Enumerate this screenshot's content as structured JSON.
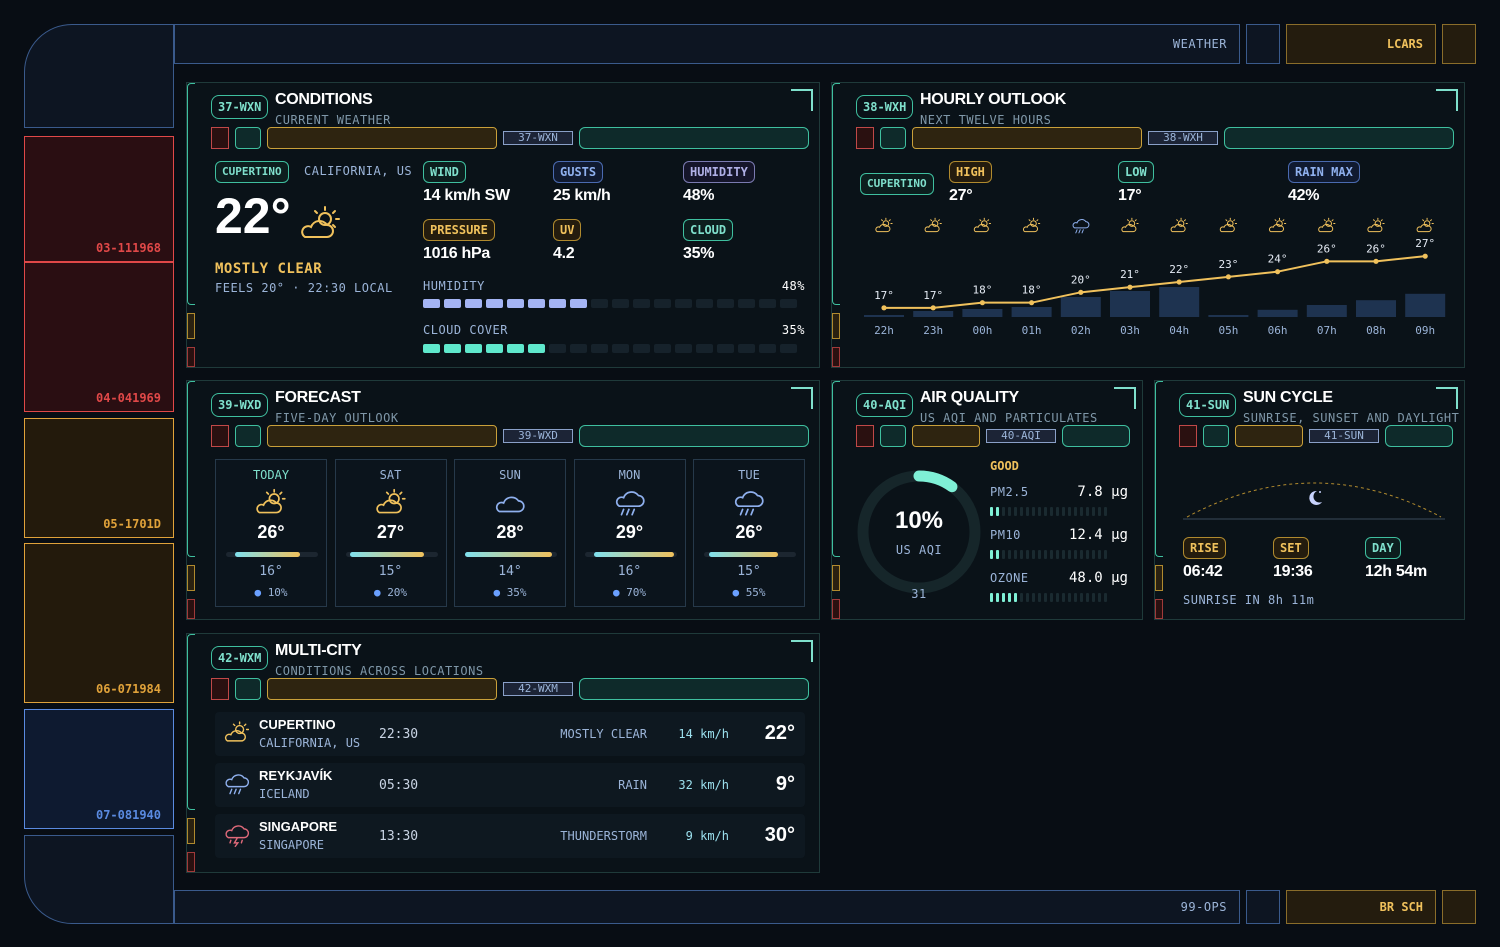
{
  "header": {
    "title": "WEATHER",
    "right_label": "LCARS"
  },
  "footer": {
    "code": "99-OPS",
    "right_label": "BR SCH"
  },
  "sidebar": {
    "tiles": [
      {
        "code": "03-111968",
        "color": "#e04848"
      },
      {
        "code": "04-041969",
        "color": "#e04848"
      },
      {
        "code": "05-1701D",
        "color": "#e0a23a"
      },
      {
        "code": "06-071984",
        "color": "#e0a23a"
      },
      {
        "code": "07-081940",
        "color": "#5a8ae0"
      }
    ]
  },
  "conditions": {
    "code": "37-WXN",
    "title": "CONDITIONS",
    "subtitle": "CURRENT WEATHER",
    "bar_code": "37-WXN",
    "city": "CUPERTINO",
    "region": "CALIFORNIA, US",
    "temp": "22°",
    "summary": "MOSTLY CLEAR",
    "feels": "FEELS 20° · 22:30 LOCAL",
    "stats": [
      {
        "label": "WIND",
        "value": "14 km/h SW",
        "style": "teal"
      },
      {
        "label": "GUSTS",
        "value": "25 km/h",
        "style": "blue"
      },
      {
        "label": "HUMIDITY",
        "value": "48%",
        "style": "lav"
      },
      {
        "label": "PRESSURE",
        "value": "1016 hPa",
        "style": "gold"
      },
      {
        "label": "UV",
        "value": "4.2",
        "style": "gold"
      },
      {
        "label": "CLOUD",
        "value": "35%",
        "style": "teal"
      }
    ],
    "humidity_label": "HUMIDITY",
    "humidity_value": "48%",
    "humidity_fraction": 0.48,
    "cloud_label": "CLOUD COVER",
    "cloud_value": "35%",
    "cloud_fraction": 0.35
  },
  "hourly": {
    "code": "38-WXH",
    "title": "HOURLY OUTLOOK",
    "subtitle": "NEXT TWELVE HOURS",
    "bar_code": "38-WXH",
    "city": "CUPERTINO",
    "high_label": "HIGH",
    "high_value": "27°",
    "low_label": "LOW",
    "low_value": "17°",
    "rain_label": "RAIN MAX",
    "rain_value": "42%"
  },
  "chart_data": {
    "type": "line",
    "x": [
      "22h",
      "23h",
      "00h",
      "01h",
      "02h",
      "03h",
      "04h",
      "05h",
      "06h",
      "07h",
      "08h",
      "09h"
    ],
    "series": [
      {
        "values": [
          17,
          17,
          18,
          18,
          20,
          21,
          22,
          23,
          24,
          26,
          26,
          27
        ]
      }
    ],
    "temp_labels": [
      "17°",
      "17°",
      "18°",
      "18°",
      "20°",
      "21°",
      "22°",
      "23°",
      "24°",
      "26°",
      "26°",
      "27°"
    ],
    "precip": [
      0.05,
      0.15,
      0.2,
      0.25,
      0.5,
      0.65,
      0.75,
      0.05,
      0.18,
      0.3,
      0.42,
      0.58
    ],
    "icons": [
      "partly",
      "partly",
      "partly",
      "partly",
      "rain",
      "partly",
      "partly",
      "partly",
      "partly",
      "partly",
      "partly",
      "partly"
    ]
  },
  "forecast": {
    "code": "39-WXD",
    "title": "FORECAST",
    "subtitle": "FIVE-DAY OUTLOOK",
    "bar_code": "39-WXD",
    "days": [
      {
        "name": "TODAY",
        "icon": "partly",
        "hi": "26°",
        "lo": "16°",
        "pop": "10%",
        "range": [
          0.1,
          0.8
        ]
      },
      {
        "name": "SAT",
        "icon": "partly",
        "hi": "27°",
        "lo": "15°",
        "pop": "20%",
        "range": [
          0.05,
          0.85
        ]
      },
      {
        "name": "SUN",
        "icon": "cloud",
        "hi": "28°",
        "lo": "14°",
        "pop": "35%",
        "range": [
          0.0,
          0.95
        ]
      },
      {
        "name": "MON",
        "icon": "rain",
        "hi": "29°",
        "lo": "16°",
        "pop": "70%",
        "range": [
          0.1,
          0.97
        ]
      },
      {
        "name": "TUE",
        "icon": "rain",
        "hi": "26°",
        "lo": "15°",
        "pop": "55%",
        "range": [
          0.05,
          0.8
        ]
      }
    ]
  },
  "air": {
    "code": "40-AQI",
    "title": "AIR QUALITY",
    "subtitle": "US AQI AND PARTICULATES",
    "bar_code": "40-AQI",
    "percent": "10%",
    "unit": "US AQI",
    "aqi": "31",
    "fraction": 0.1,
    "status": "GOOD",
    "rows": [
      {
        "label": "PM2.5",
        "value": "7.8 µg",
        "fill": 2
      },
      {
        "label": "PM10",
        "value": "12.4 µg",
        "fill": 2
      },
      {
        "label": "OZONE",
        "value": "48.0 µg",
        "fill": 5
      }
    ]
  },
  "sun": {
    "code": "41-SUN",
    "title": "SUN CYCLE",
    "subtitle": "SUNRISE, SUNSET AND DAYLIGHT",
    "bar_code": "41-SUN",
    "rise_label": "RISE",
    "rise_value": "06:42",
    "set_label": "SET",
    "set_value": "19:36",
    "day_label": "DAY",
    "day_value": "12h 54m",
    "note": "SUNRISE IN 8h 11m"
  },
  "multicity": {
    "code": "42-WXM",
    "title": "MULTI-CITY",
    "subtitle": "CONDITIONS ACROSS LOCATIONS",
    "bar_code": "42-WXM",
    "rows": [
      {
        "icon": "partly",
        "name": "CUPERTINO",
        "region": "CALIFORNIA, US",
        "time": "22:30",
        "cond": "MOSTLY CLEAR",
        "wind": "14 km/h",
        "temp": "22°"
      },
      {
        "icon": "rain",
        "name": "REYKJAVÍK",
        "region": "ICELAND",
        "time": "05:30",
        "cond": "RAIN",
        "wind": "32 km/h",
        "temp": "9°"
      },
      {
        "icon": "storm",
        "name": "SINGAPORE",
        "region": "SINGAPORE",
        "time": "13:30",
        "cond": "THUNDERSTORM",
        "wind": "9 km/h",
        "temp": "30°"
      }
    ]
  },
  "colors": {
    "teal": "#7fe0cc",
    "gold": "#f0c15c",
    "blue": "#8fb0ee",
    "red": "#e04848"
  }
}
